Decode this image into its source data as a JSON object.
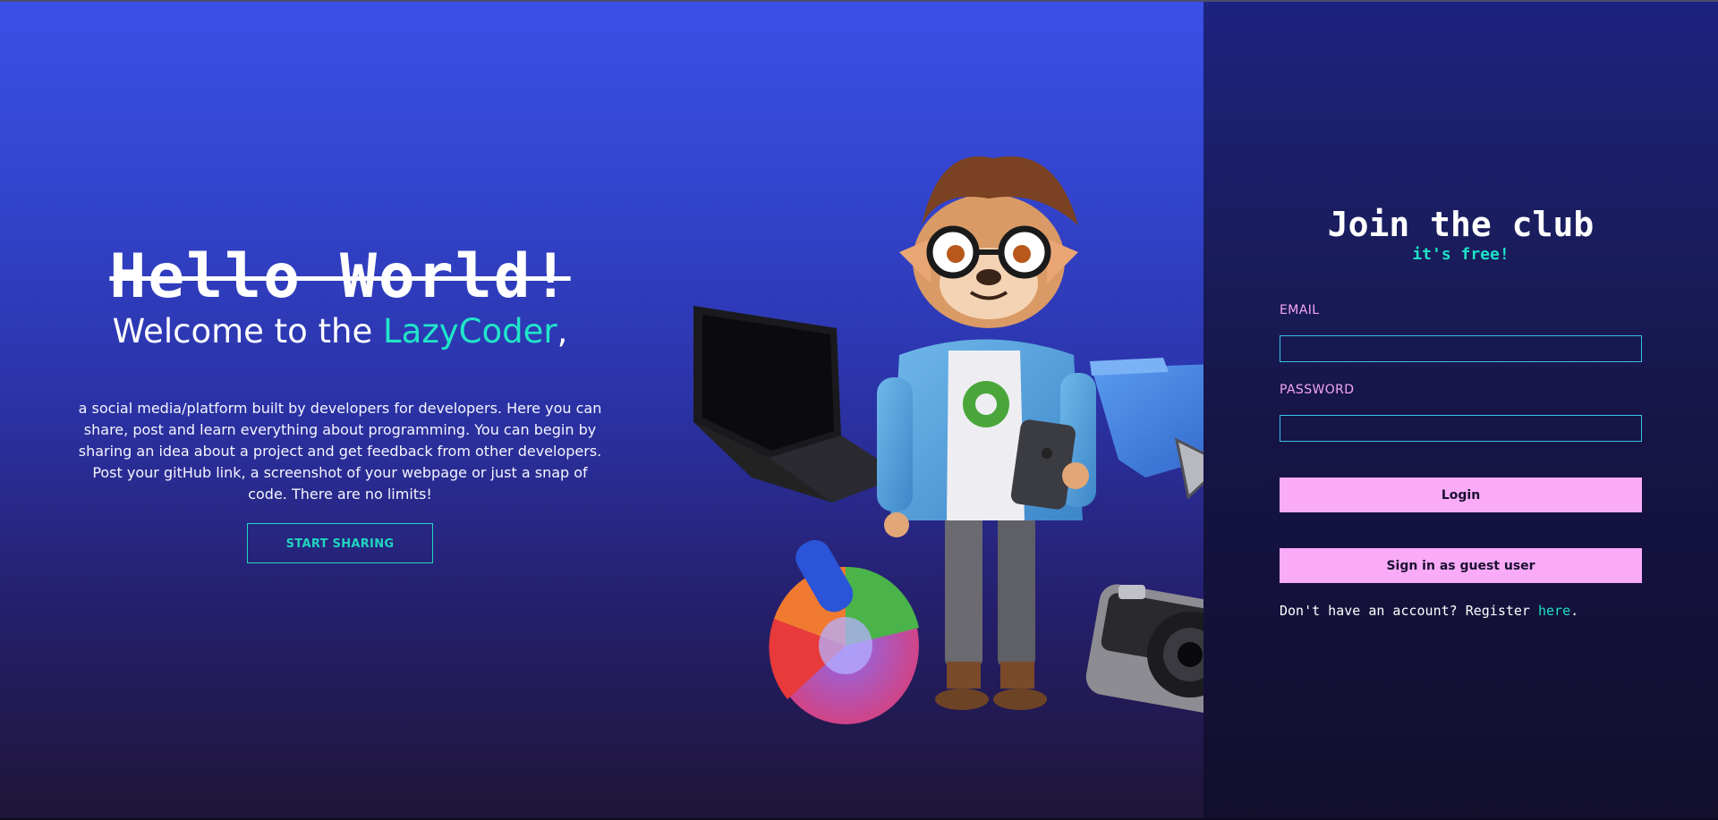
{
  "hero": {
    "strike_title": "Hello World!",
    "welcome_prefix": "Welcome to the ",
    "brand": "LazyCoder",
    "welcome_suffix": ",",
    "description": "a social media/platform built by developers for developers. Here you can share, post and learn everything about programming. You can begin by sharing an idea about a project and get feedback from other developers. Post your gitHub link, a screenshot of your webpage or just a snap of code. There are no limits!",
    "cta_label": "START SHARING"
  },
  "illustration": {
    "icons": [
      "laptop-icon",
      "developer-character",
      "tablet-icon",
      "folder-icon",
      "cursor-icon",
      "color-wheel-icon",
      "camera-icon"
    ]
  },
  "login": {
    "title": "Join the club",
    "subtitle": "it's free!",
    "email_label": "EMAIL",
    "email_value": "",
    "password_label": "PASSWORD",
    "password_value": "",
    "login_label": "Login",
    "guest_label": "Sign in as guest user",
    "register_text": "Don't have an account? Register ",
    "register_link": "here",
    "register_end": "."
  },
  "colors": {
    "accent": "#1ee0c6",
    "pink": "#f9abf8",
    "label_pink": "#f5a6f4",
    "hero_top": "#3a50e6",
    "panel": "#1a1d5e"
  }
}
